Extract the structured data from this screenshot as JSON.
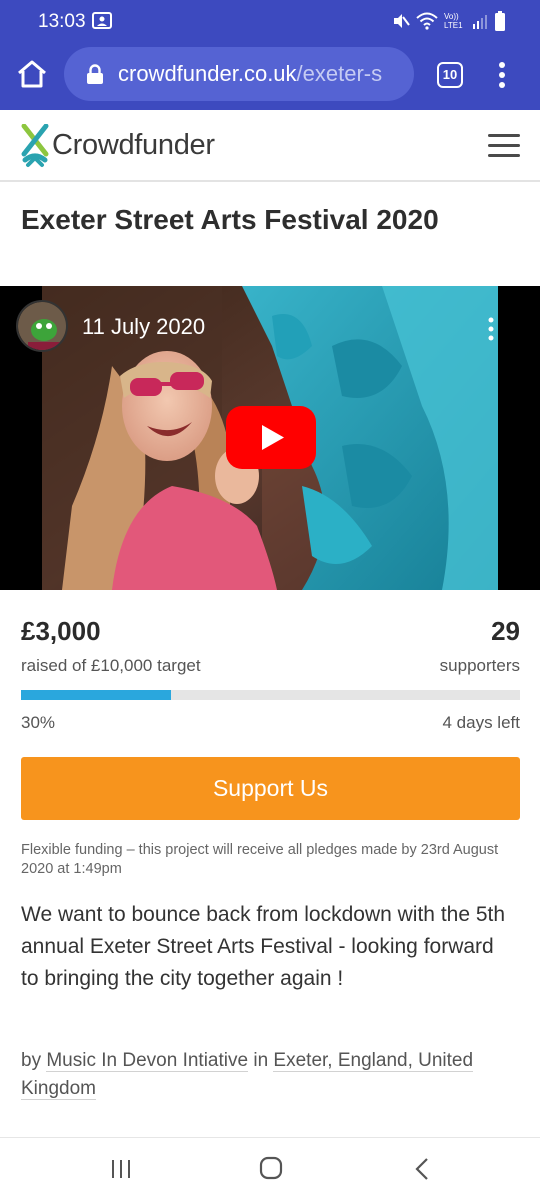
{
  "status_bar": {
    "time": "13:03",
    "network_label": "Vo)) LTE1"
  },
  "browser": {
    "url_domain": "crowdfunder.co.uk",
    "url_path": "/exeter-s",
    "tab_count": "10"
  },
  "site": {
    "logo_text": "Crowdfunder"
  },
  "project": {
    "title": "Exeter Street Arts Festival 2020",
    "video_title": "11 July 2020",
    "raised": "£3,000",
    "raised_label": "raised of £10,000 target",
    "supporters": "29",
    "supporters_label": "supporters",
    "progress_fraction": 0.3,
    "percent_label": "30%",
    "days_left": "4 days left",
    "support_button": "Support Us",
    "flexible_note": "Flexible funding – this project will receive all pledges made by 23rd August 2020 at 1:49pm",
    "description": "We want to bounce back from lockdown with the 5th annual Exeter Street Arts Festival - looking forward to bringing the city together again !",
    "by_word": "by",
    "owner": "Music In Devon Intiative",
    "in_word": "in",
    "location": "Exeter, England, United Kingdom"
  },
  "colors": {
    "browser_bar": "#3d4abf",
    "accent_orange": "#f7941d",
    "progress_blue": "#2aa7dd",
    "logo_teal": "#2aa3b0"
  },
  "icons": [
    "notification-icon",
    "mute-icon",
    "wifi-icon",
    "signal-icon",
    "battery-icon",
    "home-icon",
    "lock-icon",
    "tabs-icon",
    "more-vert-icon",
    "crowdfunder-logo-icon",
    "hamburger-menu-icon",
    "play-icon",
    "recents-icon",
    "android-home-icon",
    "back-icon"
  ]
}
